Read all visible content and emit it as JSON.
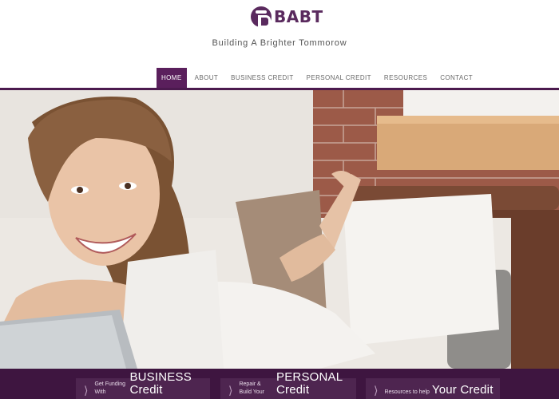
{
  "brand": {
    "name": "BABT",
    "tagline": "Building A Brighter Tommorow",
    "accent_color": "#5a1f5c",
    "dark_color": "#3e1540"
  },
  "nav": {
    "items": [
      {
        "label": "HOME",
        "active": true
      },
      {
        "label": "ABOUT",
        "active": false
      },
      {
        "label": "BUSINESS CREDIT",
        "active": false
      },
      {
        "label": "PERSONAL CREDIT",
        "active": false
      },
      {
        "label": "RESOURCES",
        "active": false
      },
      {
        "label": "CONTACT",
        "active": false
      }
    ]
  },
  "hero": {
    "image": "woman-smiling-at-laptop-photo"
  },
  "cta": [
    {
      "small": "Get Funding With",
      "big": "BUSINESS Credit",
      "icon": "chevron-right-icon"
    },
    {
      "small": "Repair & Build Your",
      "big": "PERSONAL Credit",
      "icon": "chevron-right-icon"
    },
    {
      "small": "Resources to help",
      "big": "Your Credit",
      "icon": "chevron-right-icon"
    }
  ]
}
